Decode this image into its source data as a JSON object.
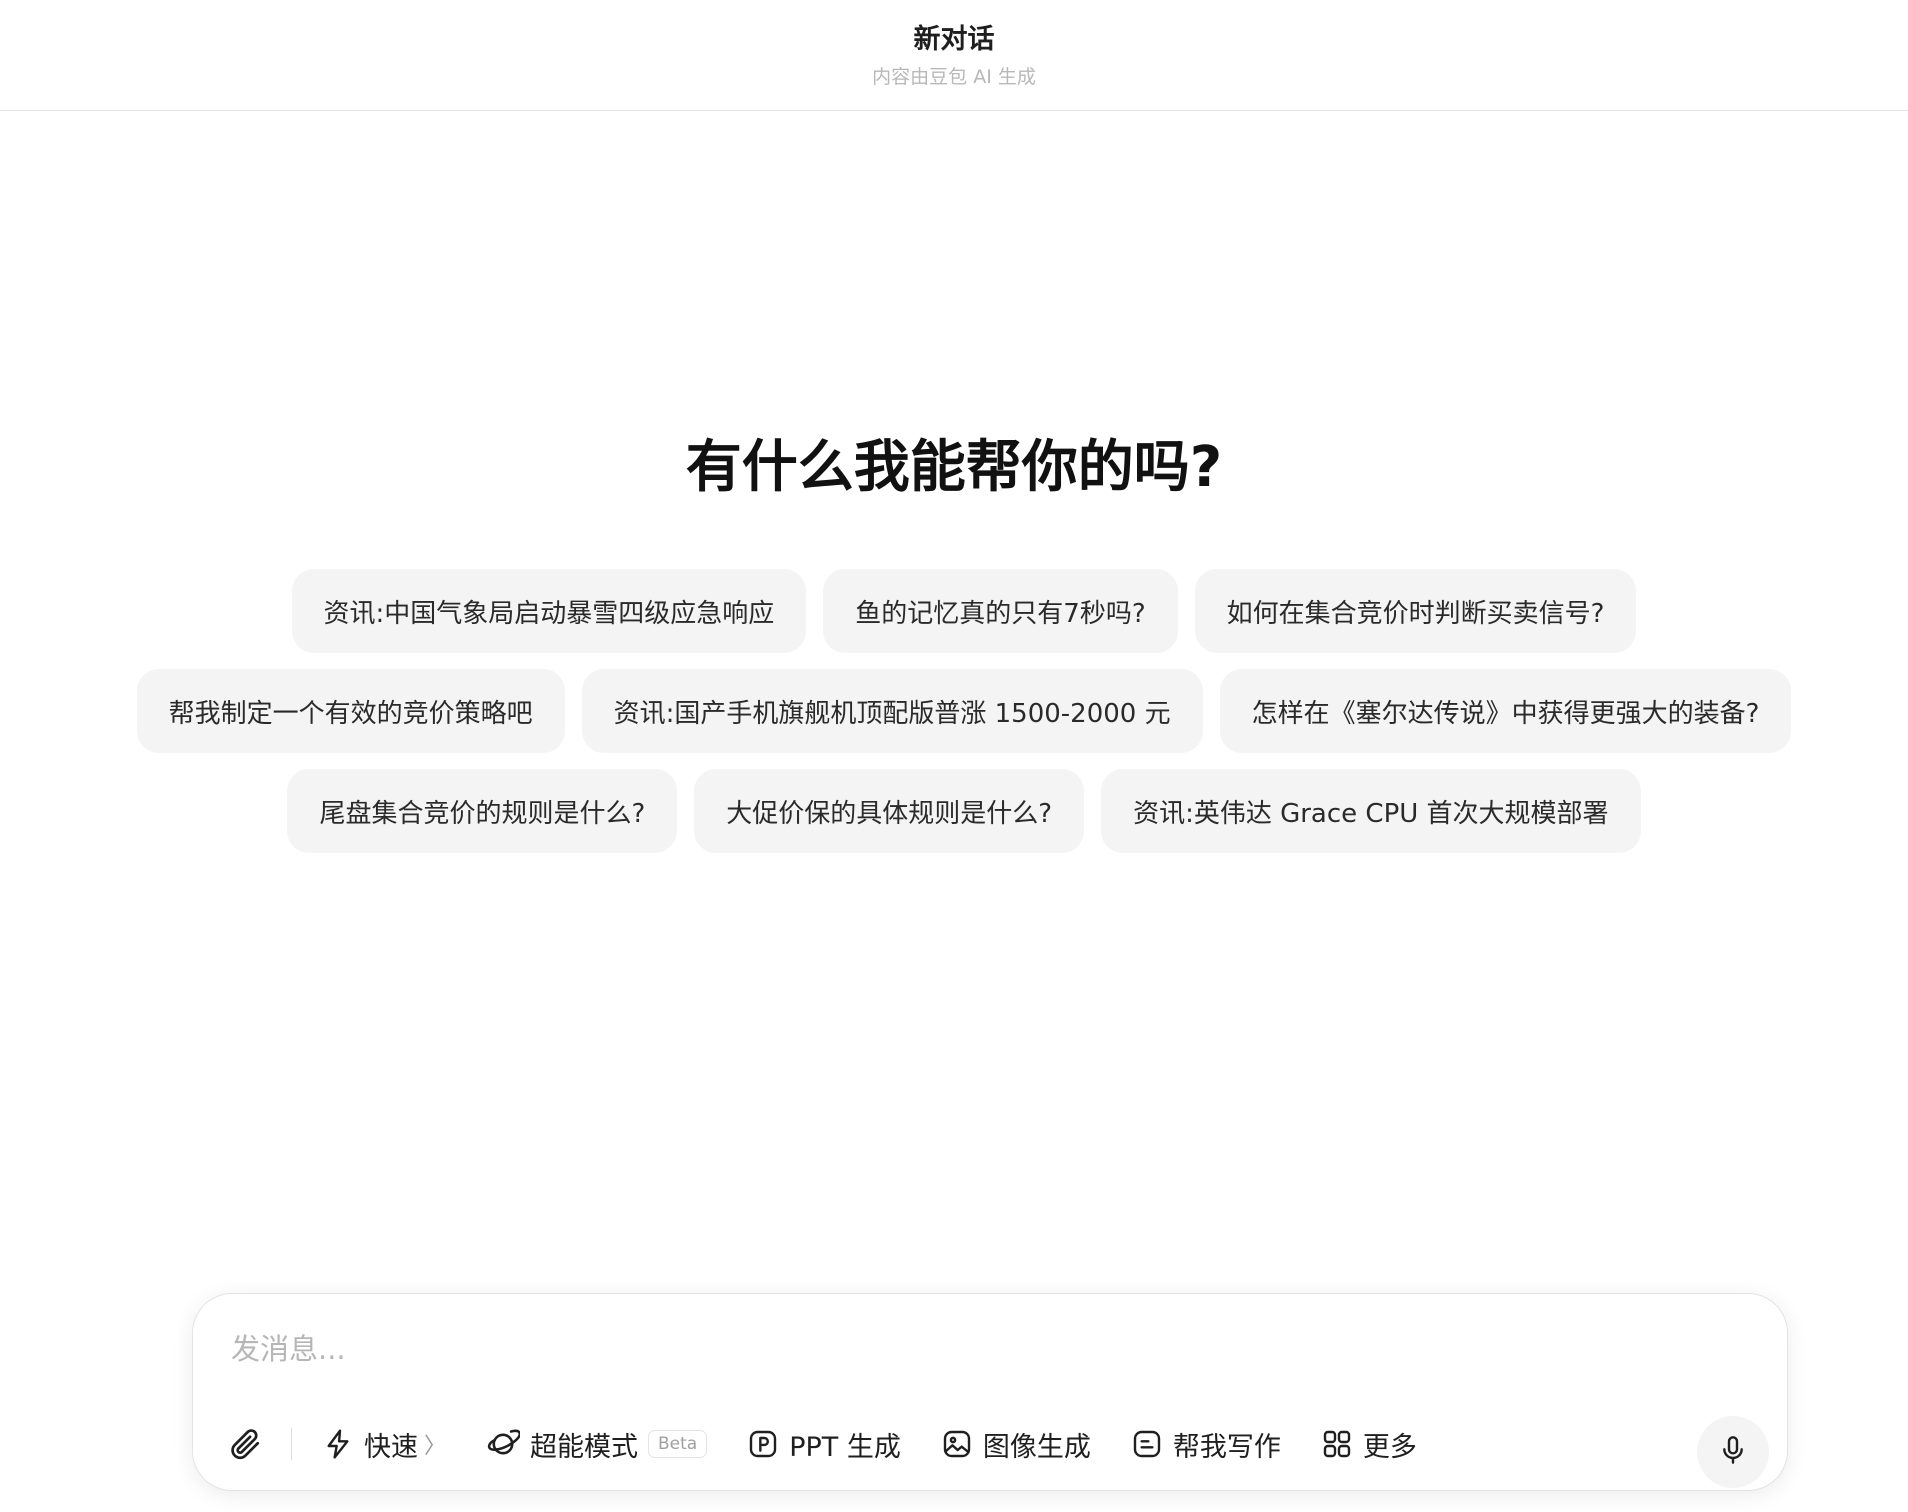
{
  "header": {
    "title": "新对话",
    "subtitle": "内容由豆包 AI 生成"
  },
  "welcome": {
    "heading": "有什么我能帮你的吗?"
  },
  "suggestions": {
    "row1": [
      "资讯:中国气象局启动暴雪四级应急响应",
      "鱼的记忆真的只有7秒吗?",
      "如何在集合竞价时判断买卖信号?"
    ],
    "row2": [
      "帮我制定一个有效的竞价策略吧",
      "资讯:国产手机旗舰机顶配版普涨 1500-2000 元",
      "怎样在《塞尔达传说》中获得更强大的装备?"
    ],
    "row3": [
      "尾盘集合竞价的规则是什么?",
      "大促价保的具体规则是什么?",
      "资讯:英伟达 Grace CPU 首次大规模部署"
    ]
  },
  "composer": {
    "placeholder": "发消息...",
    "value": "",
    "tools": {
      "fast": "快速",
      "fast_chevron": "〉",
      "super_mode": "超能模式",
      "beta": "Beta",
      "ppt": "PPT 生成",
      "image": "图像生成",
      "write": "帮我写作",
      "more": "更多"
    },
    "icons": {
      "attach": "paperclip-icon",
      "fast": "lightning-icon",
      "super_mode": "planet-icon",
      "ppt": "ppt-icon",
      "image": "image-icon",
      "write": "writing-icon",
      "more": "grid-icon",
      "voice": "microphone-icon"
    }
  }
}
